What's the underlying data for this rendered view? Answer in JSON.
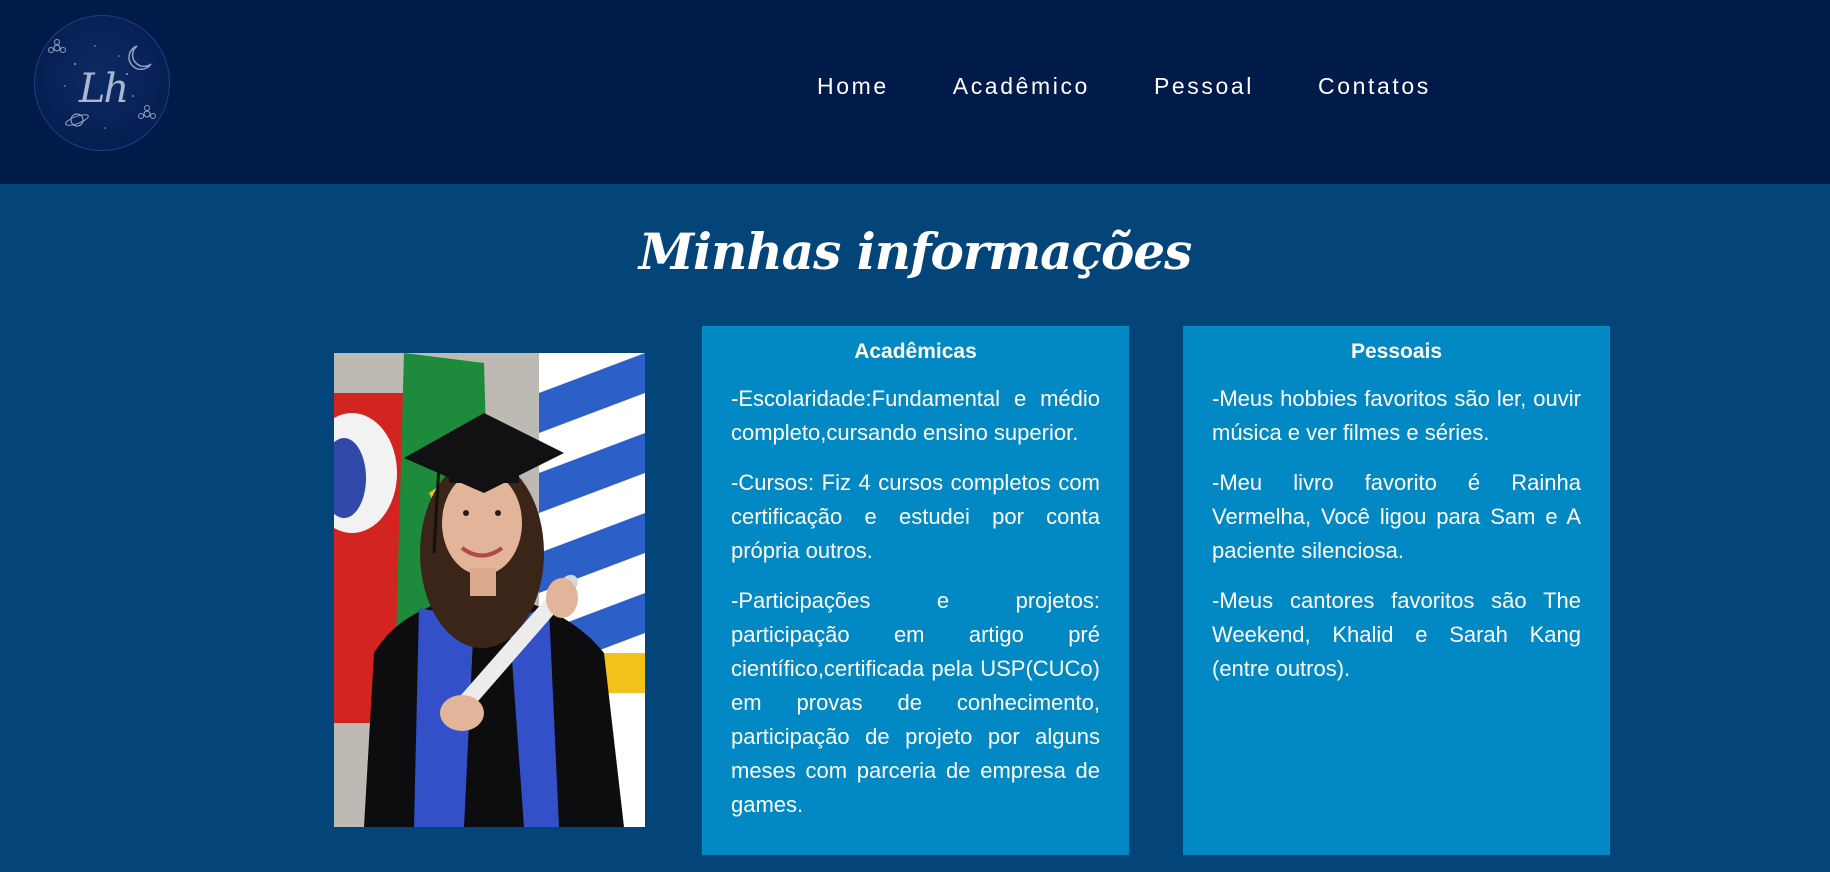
{
  "header": {
    "logo_initials": "Lh",
    "nav": [
      "Home",
      "Acadêmico",
      "Pessoal",
      "Contatos"
    ]
  },
  "main": {
    "title": "Minhas informações",
    "academic": {
      "title": "Acadêmicas",
      "paragraphs": [
        "-Escolaridade:Fundamental e médio completo,cursando ensino superior.",
        "-Cursos: Fiz 4 cursos completos com certificação e estudei por conta própria outros.",
        "-Participações e projetos: participação em artigo pré científico,certificada pela USP(CUCo) em provas de conhecimento, participação de projeto por alguns meses com parceria de empresa de games."
      ]
    },
    "personal": {
      "title": "Pessoais",
      "paragraphs": [
        "-Meus hobbies favoritos são ler, ouvir música e ver filmes e séries.",
        "-Meu livro favorito é Rainha Vermelha, Você ligou para Sam e A paciente silenciosa.",
        "-Meus cantores favoritos são The Weekend, Khalid e Sarah Kang (entre outros)."
      ]
    }
  },
  "colors": {
    "header_bg": "#001a4a",
    "page_bg": "#034579",
    "card_bg": "#0288c2",
    "text": "#ffffff"
  }
}
